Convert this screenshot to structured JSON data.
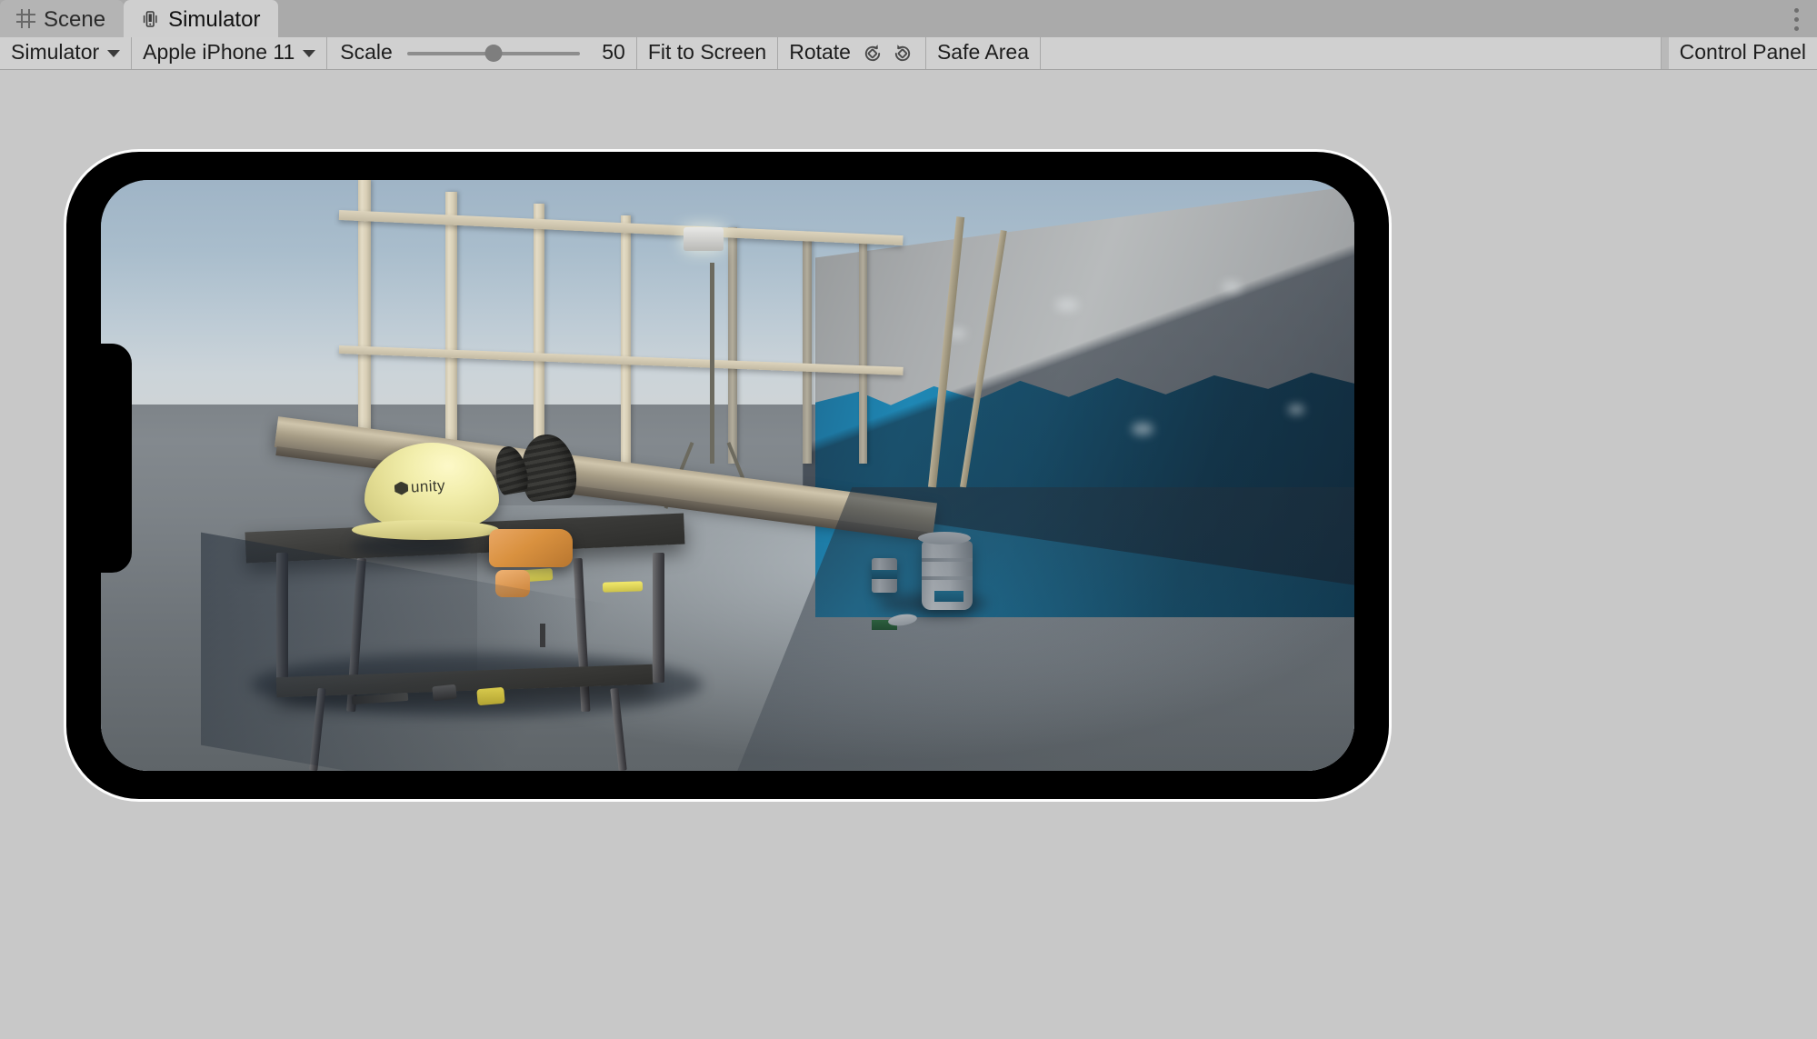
{
  "window": {
    "menu_icon": "kebab-menu-icon"
  },
  "tabs": [
    {
      "id": "scene",
      "label": "Scene",
      "icon": "grid-icon",
      "active": false
    },
    {
      "id": "simulator",
      "label": "Simulator",
      "icon": "device-icon",
      "active": true
    }
  ],
  "toolbar": {
    "mode_dropdown": {
      "label": "Simulator",
      "icon": "chevron-down-icon"
    },
    "device_dropdown": {
      "label": "Apple iPhone 11",
      "icon": "chevron-down-icon"
    },
    "scale": {
      "label": "Scale",
      "value": "50",
      "min": 0,
      "max": 100,
      "percent": 50
    },
    "fit_to_screen": {
      "label": "Fit to Screen"
    },
    "rotate": {
      "label": "Rotate",
      "counter_clockwise_icon": "rotate-counter-clockwise-icon",
      "clockwise_icon": "rotate-clockwise-icon"
    },
    "safe_area": {
      "label": "Safe Area"
    },
    "control_panel": {
      "label": "Control Panel"
    }
  },
  "simulator": {
    "device_name": "Apple iPhone 11",
    "orientation": "landscape-left",
    "notch": "left-edge-notch",
    "scene_description": "Construction site interior with sawhorse workbench, Unity hard hat, orange jigsaw, lumber plank, paint buckets and blue painted wall"
  },
  "scene_objects": {
    "hardhat": {
      "brand": "unity",
      "color": "#eee59a"
    },
    "jigsaw": {
      "color": "#d9913f"
    },
    "wall_paint_color": "#1a7ba6",
    "floor_color": "#7e8489",
    "sky_top_color": "#9fb4c6"
  },
  "colors": {
    "tabbar_bg": "#aaaaaa",
    "tab_active_bg": "#cfcfcf",
    "tab_inactive_bg": "#b4b4b4",
    "toolbar_btn_bg": "#d0d0d0",
    "toolbar_bg": "#b9b9b9",
    "viewport_bg": "#c8c8c8",
    "device_bezel": "#000000",
    "device_outline": "#fdfdfd",
    "text": "#1d1d1d"
  }
}
